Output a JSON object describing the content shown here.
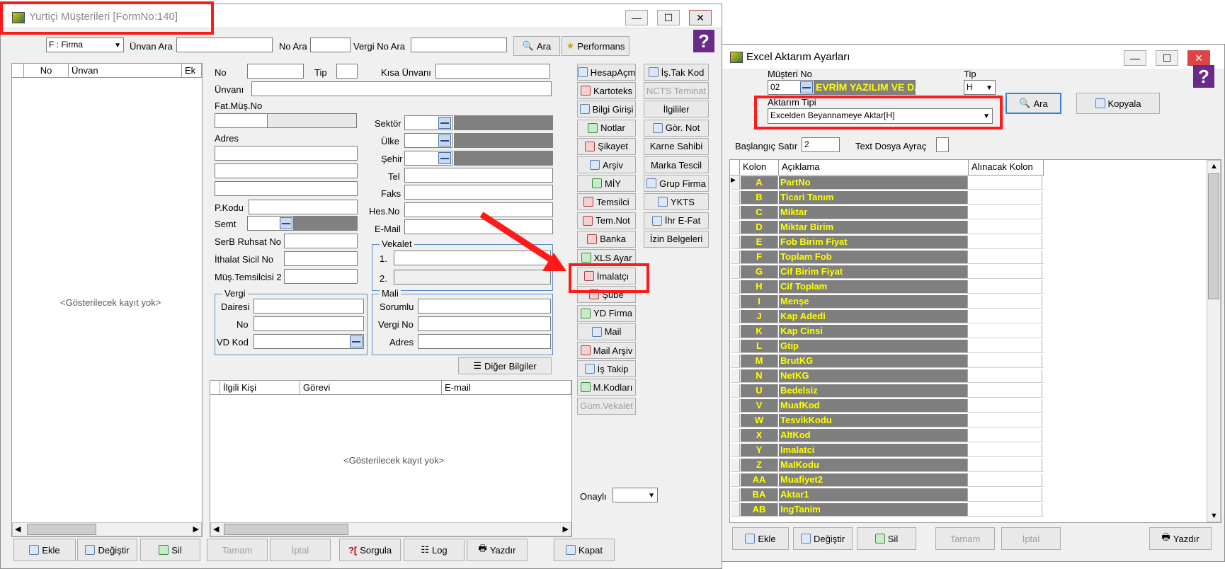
{
  "main": {
    "title": "Yurtiçi Müşterileri [FormNo:140]",
    "firm_select": "F : Firma",
    "search": {
      "unvan_label": "Ünvan Ara",
      "no_label": "No Ara",
      "vergi_label": "Vergi No Ara",
      "ara": "Ara",
      "performans": "Performans"
    },
    "list": {
      "col_no": "No",
      "col_unvan": "Ünvan",
      "col_ek": "Ek",
      "empty": "<Gösterilecek kayıt yok>"
    },
    "form": {
      "no": "No",
      "tip": "Tip",
      "kisa_unvan": "Kısa Ünvanı",
      "unvan": "Ünvanı",
      "fat_mus_no": "Fat.Müş.No",
      "adres": "Adres",
      "pkodu": "P.Kodu",
      "semt": "Semt",
      "serb": "SerB Ruhsat No",
      "ithalat": "İthalat Sicil No",
      "mus_tems": "Müş.Temsilcisi 2",
      "sektor": "Sektör",
      "ulke": "Ülke",
      "sehir": "Şehir",
      "tel": "Tel",
      "faks": "Faks",
      "hes_no": "Hes.No",
      "email": "E-Mail",
      "vekalet": "Vekalet",
      "v1": "1.",
      "v2": "2.",
      "vergi": "Vergi",
      "dairesi": "Dairesi",
      "vno": "No",
      "vd_kod": "VD Kod",
      "mali": "Mali",
      "sorumlu": "Sorumlu",
      "vergi_no": "Vergi No",
      "madres": "Adres",
      "diger": "Diğer Bilgiler"
    },
    "contacts": {
      "c1": "İlgili Kişi",
      "c2": "Görevi",
      "c3": "E-mail",
      "empty": "<Gösterilecek kayıt yok>"
    },
    "side_left": [
      "HesapAçm",
      "Kartoteks",
      "Bilgi Girişi",
      "Notlar",
      "Şikayet",
      "Arşiv",
      "MİY",
      "Temsilci",
      "Tem.Not",
      "Banka",
      "XLS Ayar",
      "İmalatçı",
      "Şube",
      "YD Firma",
      "Mail",
      "Mail Arşiv",
      "İş Takip",
      "M.Kodları",
      "Güm.Vekalet"
    ],
    "side_right": [
      "İş.Tak Kod",
      "NCTS Teminat",
      "İlgililer",
      "Gör. Not",
      "Karne Sahibi",
      "Marka Tescil",
      "Grup Firma",
      "YKTS",
      "İhr E-Fat",
      "İzin Belgeleri"
    ],
    "onayli": "Onaylı",
    "bottom": {
      "ekle": "Ekle",
      "degistir": "Değiştir",
      "sil": "Sil",
      "tamam": "Tamam",
      "iptal": "İptal",
      "sorgula": "Sorgula",
      "log": "Log",
      "yazdir": "Yazdır",
      "kapat": "Kapat"
    }
  },
  "excel": {
    "title": "Excel Aktarım Ayarları",
    "musteri_label": "Müşteri No",
    "musteri_no": "02",
    "musteri_name": "EVRİM YAZILIM VE DANIŞM",
    "tip_label": "Tip",
    "tip_value": "H",
    "aktarim_label": "Aktarım Tipi",
    "aktarim_value": "Excelden Beyannameye Aktar[H]",
    "ara": "Ara",
    "kopyala": "Kopyala",
    "baslangic_label": "Başlangıç Satır",
    "baslangic_value": "2",
    "text_label": "Text Dosya Ayraç",
    "cols": {
      "kolon": "Kolon",
      "aciklama": "Açıklama",
      "alinacak": "Alınacak Kolon"
    },
    "rows": [
      [
        "A",
        "PartNo"
      ],
      [
        "B",
        "Ticari Tanım"
      ],
      [
        "C",
        "Miktar"
      ],
      [
        "D",
        "Miktar Birim"
      ],
      [
        "E",
        "Fob Birim Fiyat"
      ],
      [
        "F",
        "Toplam Fob"
      ],
      [
        "G",
        "Cif Birim Fiyat"
      ],
      [
        "H",
        "Cif Toplam"
      ],
      [
        "I",
        "Menşe"
      ],
      [
        "J",
        "Kap Adedi"
      ],
      [
        "K",
        "Kap Cinsi"
      ],
      [
        "L",
        "Gtip"
      ],
      [
        "M",
        "BrutKG"
      ],
      [
        "N",
        "NetKG"
      ],
      [
        "U",
        "Bedelsiz"
      ],
      [
        "V",
        "MuafKod"
      ],
      [
        "W",
        "TesvikKodu"
      ],
      [
        "X",
        "AltKod"
      ],
      [
        "Y",
        "Imalatci"
      ],
      [
        "Z",
        "MalKodu"
      ],
      [
        "AA",
        "Muafiyet2"
      ],
      [
        "BA",
        "Aktar1"
      ],
      [
        "AB",
        "IngTanim"
      ]
    ],
    "bottom": {
      "ekle": "Ekle",
      "degistir": "Değiştir",
      "sil": "Sil",
      "tamam": "Tamam",
      "iptal": "İptal",
      "yazdir": "Yazdır"
    }
  }
}
